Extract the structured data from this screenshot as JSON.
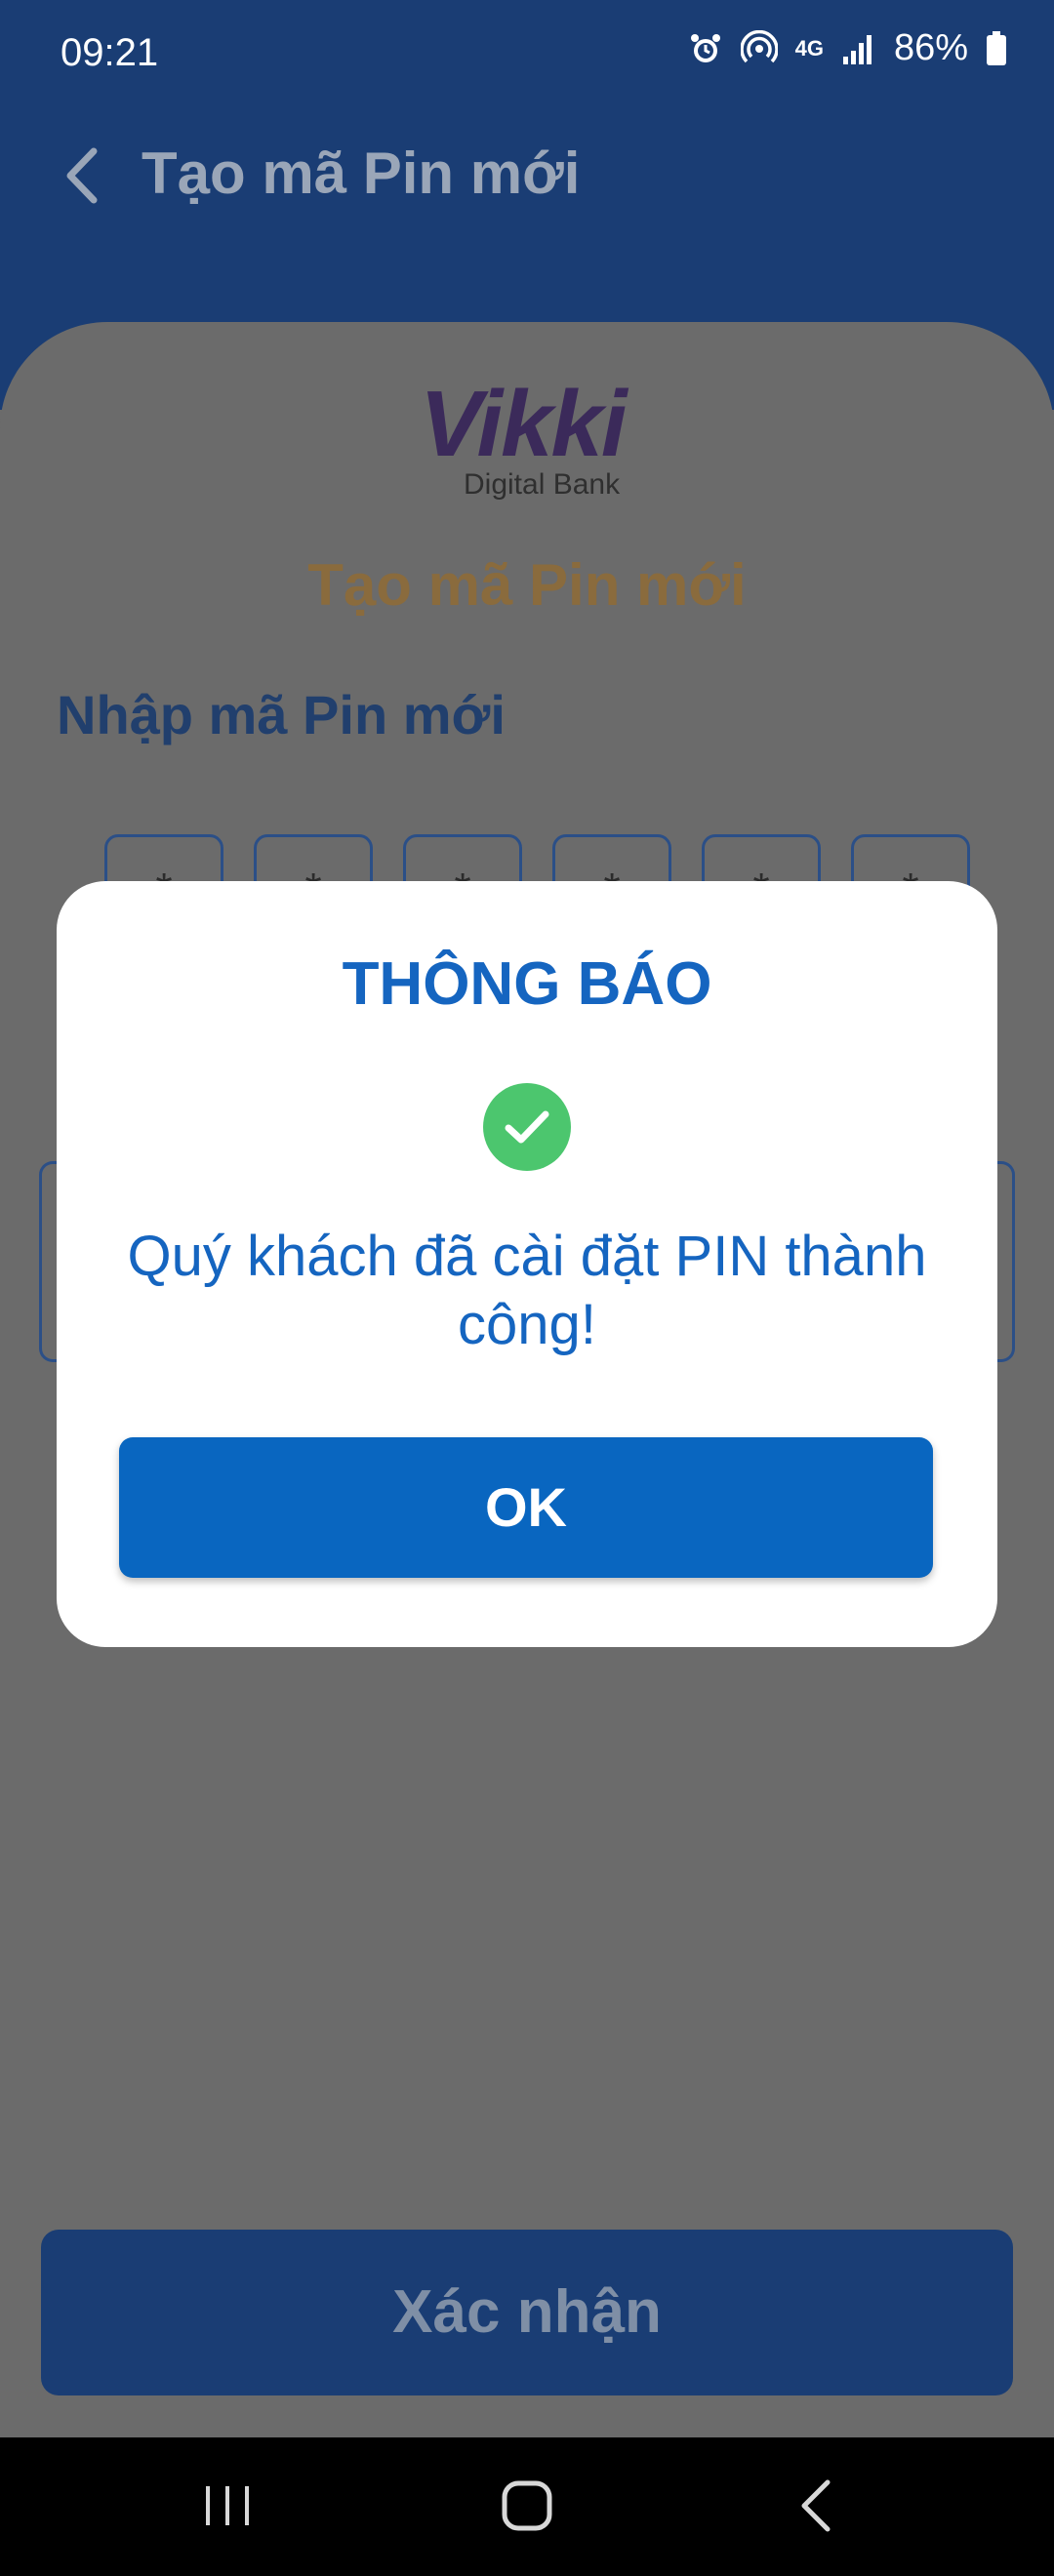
{
  "status_bar": {
    "time": "09:21",
    "network": "4G",
    "battery": "86%"
  },
  "header": {
    "title": "Tạo mã Pin mới"
  },
  "logo": {
    "word": "Vikki",
    "sub": "Digital Bank"
  },
  "card": {
    "title": "Tạo mã Pin mới",
    "pin_label": "Nhập mã Pin mới",
    "pin_placeholder": "*"
  },
  "confirm_button": {
    "label": "Xác nhận"
  },
  "dialog": {
    "title": "THÔNG BÁO",
    "message": "Quý khách đã cài đặt PIN thành công!",
    "ok_label": "OK"
  },
  "colors": {
    "header": "#1a3d74",
    "dialog_title": "#1565c0",
    "ok_button": "#0966c0",
    "success": "#4cc66e",
    "title_accent": "#e0902a"
  }
}
